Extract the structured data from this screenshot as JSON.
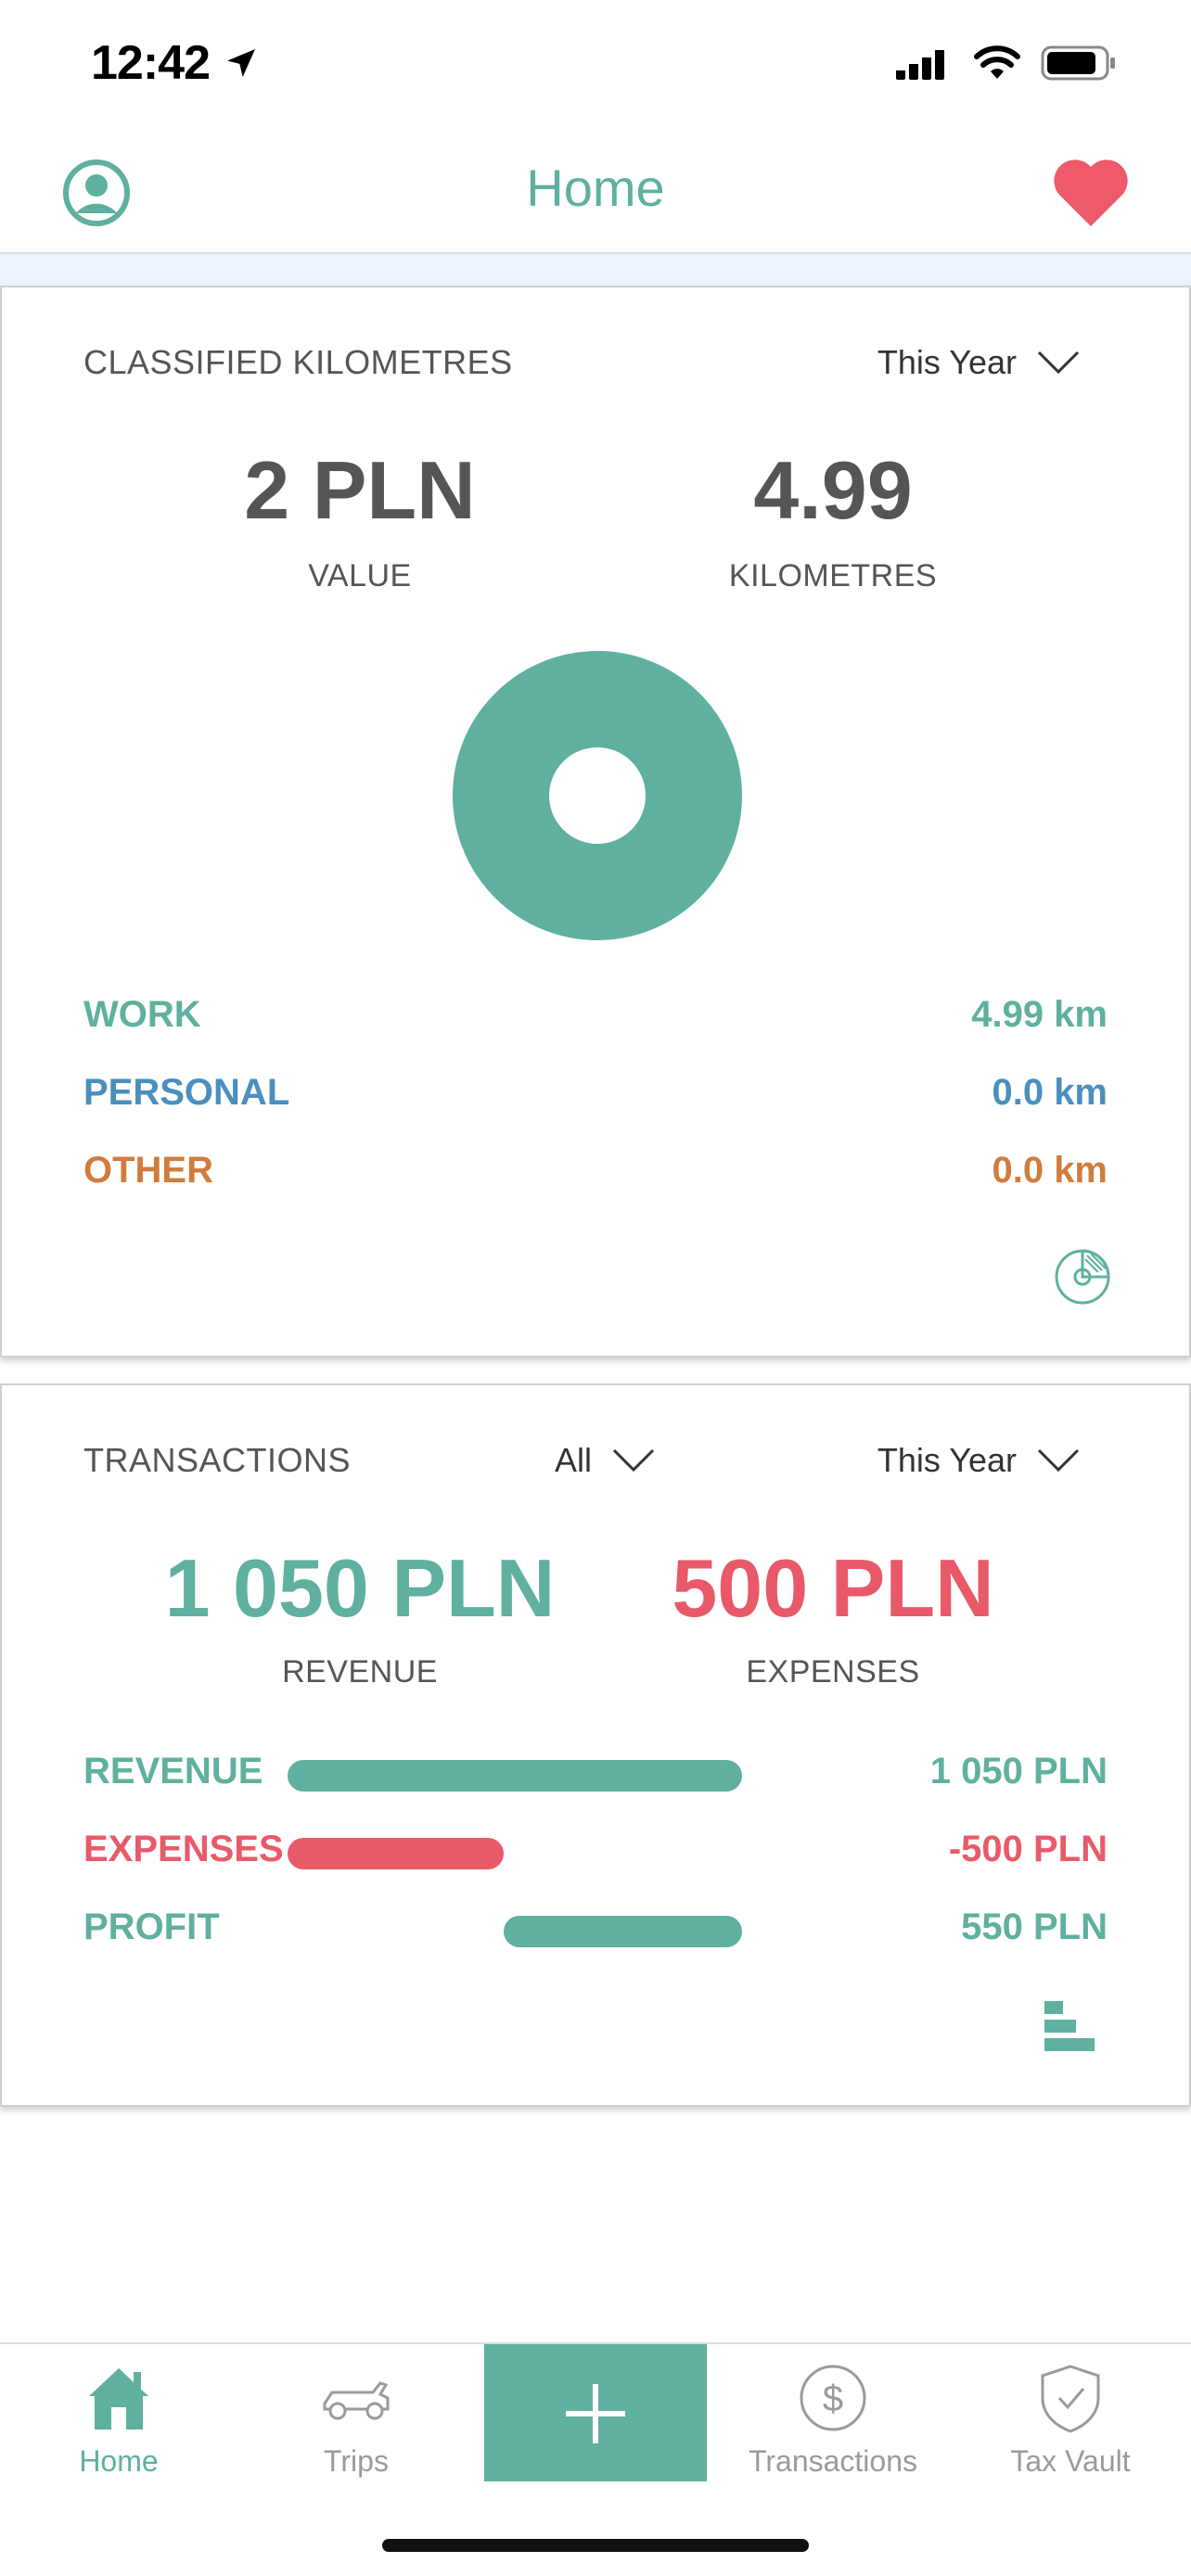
{
  "status_bar": {
    "time": "12:42",
    "icons": [
      "location-arrow-icon",
      "cellular-signal-icon",
      "wifi-icon",
      "battery-icon"
    ]
  },
  "nav": {
    "title": "Home",
    "left_icon": "profile-icon",
    "right_icon": "heart-icon"
  },
  "colors": {
    "accent": "#5fb09f",
    "personal": "#4a8fbd",
    "other": "#d17c3c",
    "expense": "#e85a6a",
    "band": "#edf3fc"
  },
  "kilometres_card": {
    "label": "CLASSIFIED KILOMETRES",
    "period": "This Year",
    "value_amount": "2 PLN",
    "value_caption": "VALUE",
    "km_amount": "4.99",
    "km_caption": "KILOMETRES",
    "donut": {
      "work": 4.99,
      "personal": 0.0,
      "other": 0.0
    },
    "legend": [
      {
        "name": "WORK",
        "value": "4.99 km"
      },
      {
        "name": "PERSONAL",
        "value": "0.0 km"
      },
      {
        "name": "OTHER",
        "value": "0.0 km"
      }
    ],
    "toggle_icon": "pie-chart-icon"
  },
  "transactions_card": {
    "label": "TRANSACTIONS",
    "filter": "All",
    "period": "This Year",
    "revenue_amount": "1 050 PLN",
    "revenue_caption": "REVENUE",
    "expenses_amount": "500 PLN",
    "expenses_caption": "EXPENSES",
    "bars": [
      {
        "name": "REVENUE",
        "value": "1 050 PLN",
        "amount": 1050
      },
      {
        "name": "EXPENSES",
        "value": "-500 PLN",
        "amount": -500
      },
      {
        "name": "PROFIT",
        "value": "550 PLN",
        "amount": 550
      }
    ],
    "toggle_icon": "bar-chart-icon"
  },
  "tabs": [
    {
      "label": "Home",
      "icon": "home-icon"
    },
    {
      "label": "Trips",
      "icon": "car-icon"
    },
    {
      "label": "",
      "icon": "plus-icon"
    },
    {
      "label": "Transactions",
      "icon": "dollar-icon"
    },
    {
      "label": "Tax Vault",
      "icon": "shield-check-icon"
    }
  ]
}
